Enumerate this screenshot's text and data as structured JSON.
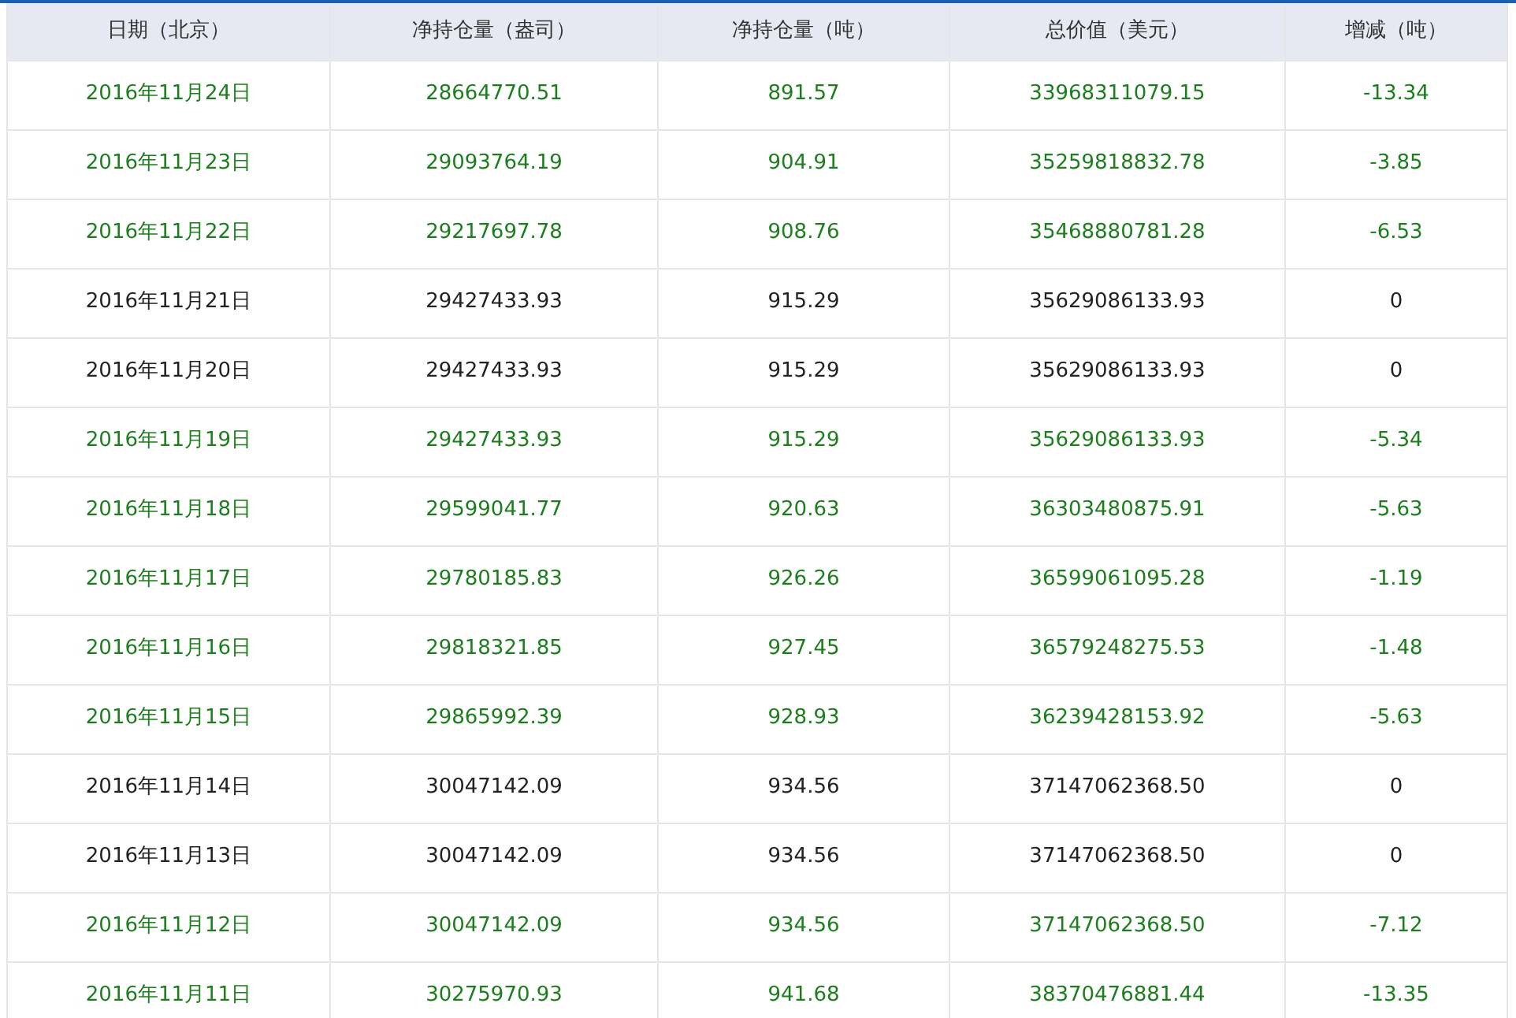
{
  "table": {
    "columns": [
      "日期（北京）",
      "净持仓量（盎司）",
      "净持仓量（吨）",
      "总价值（美元）",
      "增减（吨）"
    ],
    "rows": [
      {
        "color": "#1a7f1a",
        "cells": [
          "2016年11月24日",
          "28664770.51",
          "891.57",
          "33968311079.15",
          "-13.34"
        ]
      },
      {
        "color": "#1a7f1a",
        "cells": [
          "2016年11月23日",
          "29093764.19",
          "904.91",
          "35259818832.78",
          "-3.85"
        ]
      },
      {
        "color": "#1a7f1a",
        "cells": [
          "2016年11月22日",
          "29217697.78",
          "908.76",
          "35468880781.28",
          "-6.53"
        ]
      },
      {
        "color": "#222222",
        "cells": [
          "2016年11月21日",
          "29427433.93",
          "915.29",
          "35629086133.93",
          "0"
        ]
      },
      {
        "color": "#222222",
        "cells": [
          "2016年11月20日",
          "29427433.93",
          "915.29",
          "35629086133.93",
          "0"
        ]
      },
      {
        "color": "#1a7f1a",
        "cells": [
          "2016年11月19日",
          "29427433.93",
          "915.29",
          "35629086133.93",
          "-5.34"
        ]
      },
      {
        "color": "#1a7f1a",
        "cells": [
          "2016年11月18日",
          "29599041.77",
          "920.63",
          "36303480875.91",
          "-5.63"
        ]
      },
      {
        "color": "#1a7f1a",
        "cells": [
          "2016年11月17日",
          "29780185.83",
          "926.26",
          "36599061095.28",
          "-1.19"
        ]
      },
      {
        "color": "#1a7f1a",
        "cells": [
          "2016年11月16日",
          "29818321.85",
          "927.45",
          "36579248275.53",
          "-1.48"
        ]
      },
      {
        "color": "#1a7f1a",
        "cells": [
          "2016年11月15日",
          "29865992.39",
          "928.93",
          "36239428153.92",
          "-5.63"
        ]
      },
      {
        "color": "#222222",
        "cells": [
          "2016年11月14日",
          "30047142.09",
          "934.56",
          "37147062368.50",
          "0"
        ]
      },
      {
        "color": "#222222",
        "cells": [
          "2016年11月13日",
          "30047142.09",
          "934.56",
          "37147062368.50",
          "0"
        ]
      },
      {
        "color": "#1a7f1a",
        "cells": [
          "2016年11月12日",
          "30047142.09",
          "934.56",
          "37147062368.50",
          "-7.12"
        ]
      },
      {
        "color": "#1a7f1a",
        "cells": [
          "2016年11月11日",
          "30275970.93",
          "941.68",
          "38370476881.44",
          "-13.35"
        ]
      }
    ]
  }
}
